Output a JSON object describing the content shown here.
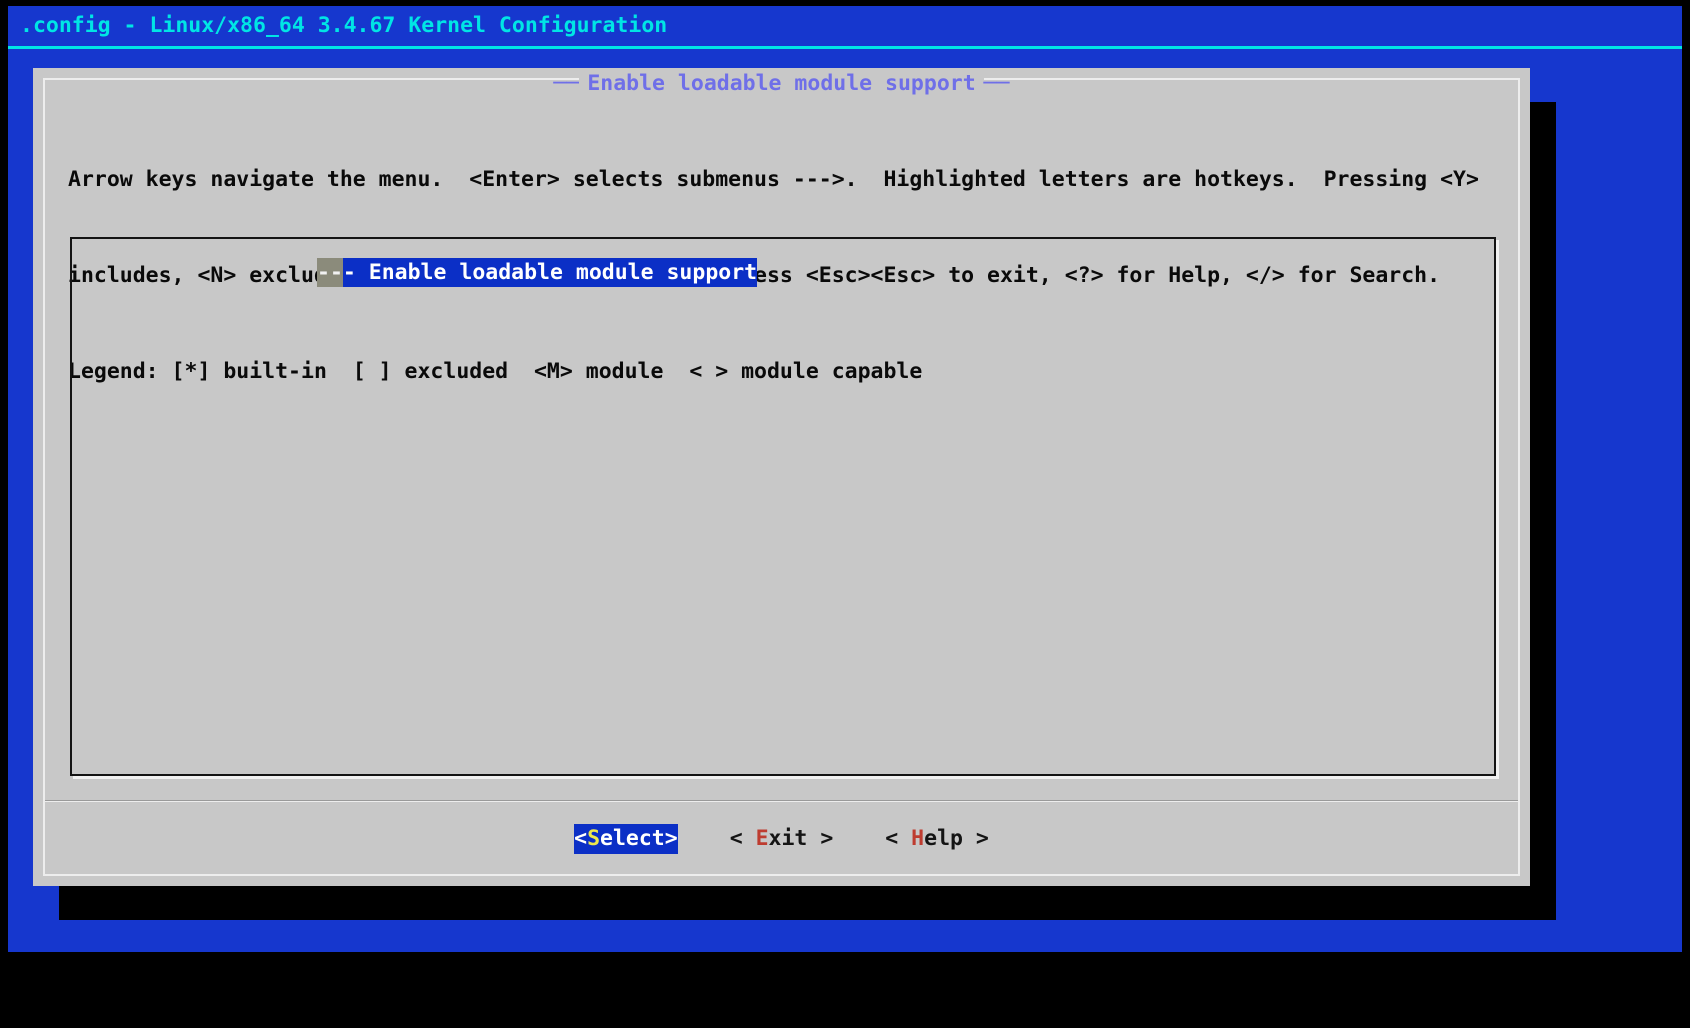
{
  "titlebar": {
    "text": ".config - Linux/x86_64 3.4.67 Kernel Configuration"
  },
  "dialog": {
    "title": "Enable loadable module support",
    "title_dash": "──",
    "help_lines": [
      "Arrow keys navigate the menu.  <Enter> selects submenus --->.  Highlighted letters are hotkeys.  Pressing <Y>",
      "includes, <N> excludes, <M> modularizes features.  Press <Esc><Esc> to exit, <?> for Help, </> for Search.",
      "Legend: [*] built-in  [ ] excluded  <M> module  < > module capable"
    ],
    "menu": {
      "selected_item": {
        "label": "--- Enable loadable module support",
        "cursor_text": "--",
        "rest_text": "- Enable loadable module support"
      }
    },
    "buttons": [
      {
        "label": "Select",
        "pre": "<",
        "hotkey": "S",
        "post": "elect>",
        "active": true
      },
      {
        "label": "Exit",
        "pre": "< ",
        "hotkey": "E",
        "post": "xit >",
        "active": false
      },
      {
        "label": "Help",
        "pre": "< ",
        "hotkey": "H",
        "post": "elp >",
        "active": false
      }
    ]
  },
  "colors": {
    "screen_bg": "#1637CE",
    "titlebar_fg": "#00E5E5",
    "dialog_bg": "#C8C8C8",
    "dialog_title_fg": "#6F6FE8",
    "highlight_bg": "#0B2FC6",
    "cursor_bg": "#8B8B7B",
    "hotkey_red": "#BE3C30",
    "active_hotkey_yellow": "#EDE74C",
    "shadow": "#000000"
  }
}
